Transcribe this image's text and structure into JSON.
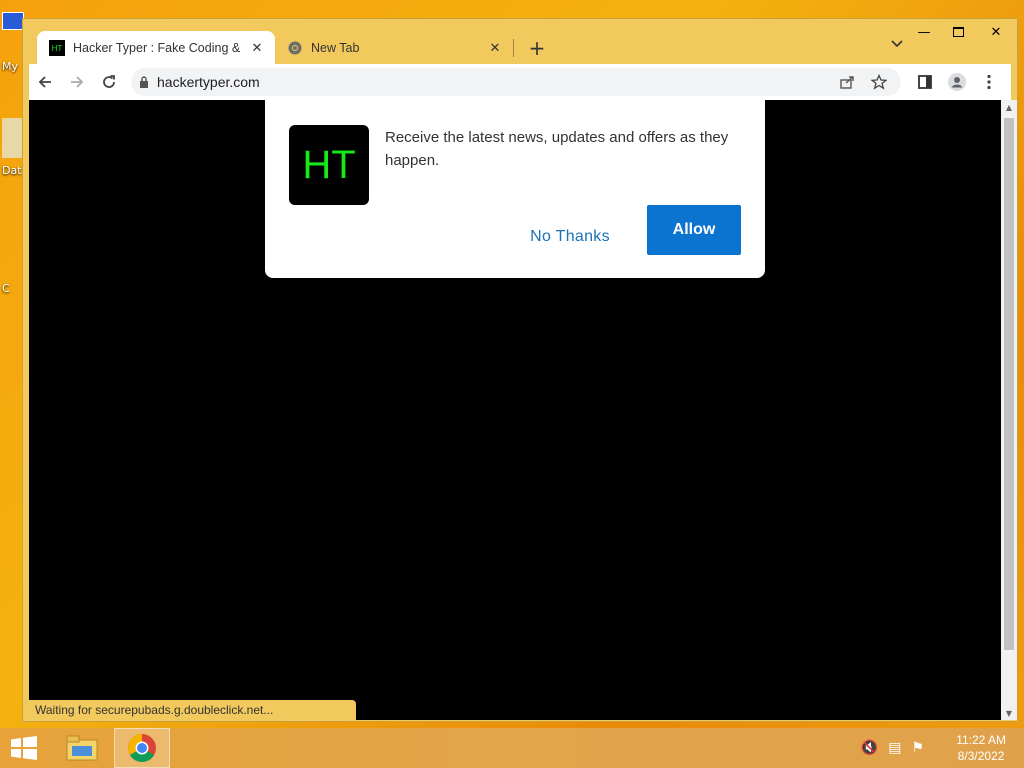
{
  "desktop": {
    "icons": [
      {
        "label": "My"
      },
      {
        "label": "Dat"
      },
      {
        "label": "C"
      }
    ]
  },
  "browser": {
    "tabs": [
      {
        "title": "Hacker Typer : Fake Coding & Ha",
        "favicon": "HT",
        "active": true
      },
      {
        "title": "New Tab",
        "favicon": "chrome-icon",
        "active": false
      }
    ],
    "url": "hackertyper.com",
    "status_text": "Waiting for securepubads.g.doubleclick.net..."
  },
  "dialog": {
    "logo_text": "HT",
    "message": "Receive the latest news, updates and offers as they happen.",
    "no_thanks_label": "No Thanks",
    "allow_label": "Allow",
    "allow_color": "#0b73d0",
    "logo_text_color": "#17e817"
  },
  "taskbar": {
    "time": "11:22 AM",
    "date": "8/3/2022"
  }
}
